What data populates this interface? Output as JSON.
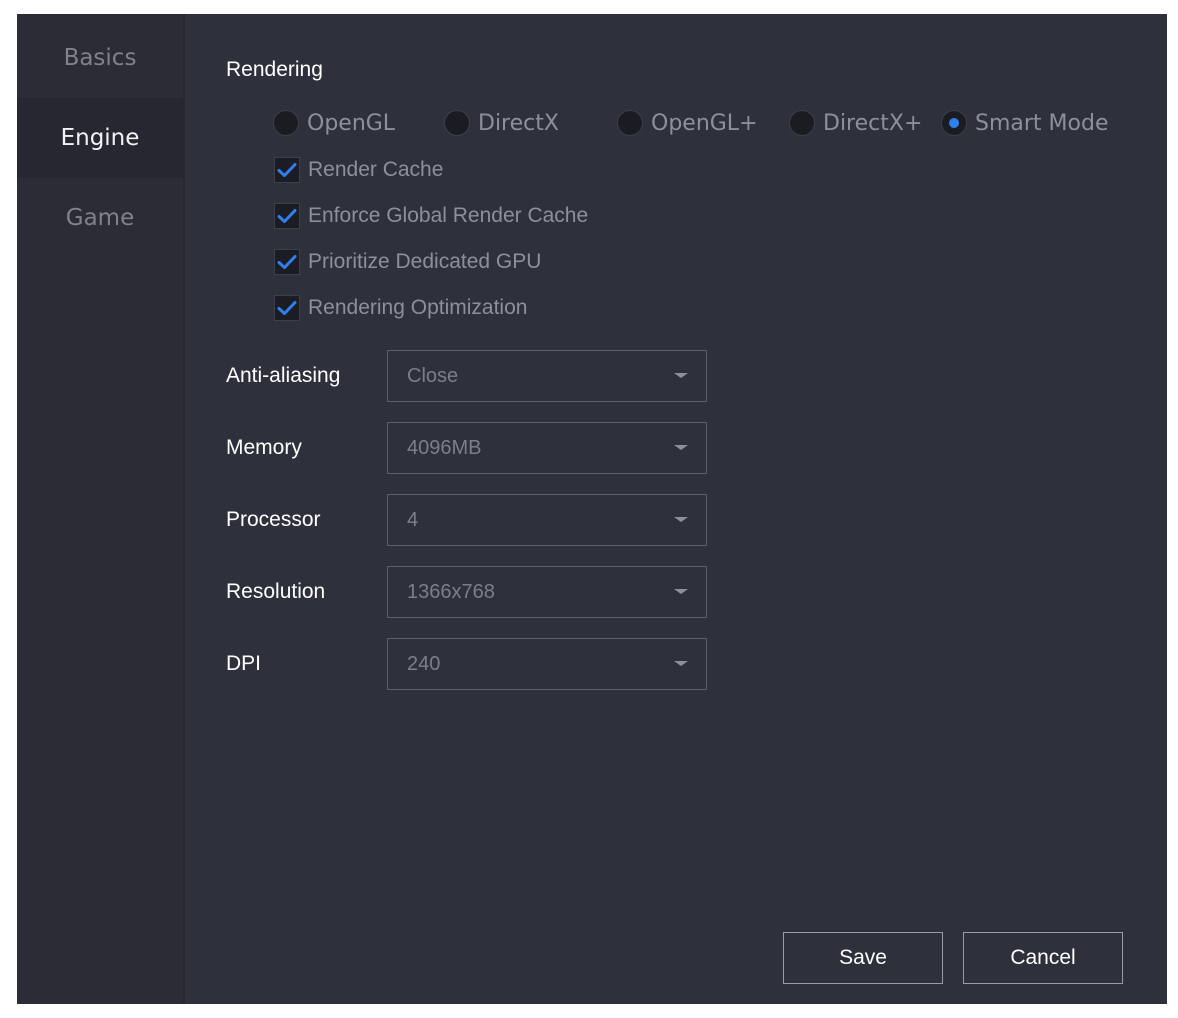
{
  "sidebar": {
    "items": [
      {
        "label": "Basics",
        "active": false
      },
      {
        "label": "Engine",
        "active": true
      },
      {
        "label": "Game",
        "active": false
      }
    ]
  },
  "rendering": {
    "title": "Rendering",
    "modes": [
      {
        "label": "OpenGL",
        "checked": false
      },
      {
        "label": "DirectX",
        "checked": false
      },
      {
        "label": "OpenGL+",
        "checked": false
      },
      {
        "label": "DirectX+",
        "checked": false
      },
      {
        "label": "Smart Mode",
        "checked": true
      }
    ],
    "options": [
      {
        "label": "Render Cache",
        "checked": true
      },
      {
        "label": "Enforce Global Render Cache",
        "checked": true
      },
      {
        "label": "Prioritize Dedicated GPU",
        "checked": true
      },
      {
        "label": "Rendering Optimization",
        "checked": true
      }
    ]
  },
  "settings": {
    "anti_aliasing": {
      "label": "Anti-aliasing",
      "value": "Close"
    },
    "memory": {
      "label": "Memory",
      "value": "4096MB"
    },
    "processor": {
      "label": "Processor",
      "value": "4"
    },
    "resolution": {
      "label": "Resolution",
      "value": "1366x768"
    },
    "dpi": {
      "label": "DPI",
      "value": "240"
    }
  },
  "actions": {
    "save_label": "Save",
    "cancel_label": "Cancel"
  },
  "colors": {
    "background": "#2e303c",
    "sidebar": "#2b2c36",
    "accent": "#2f80ed"
  },
  "icons": {
    "check": "checkmark-icon",
    "dropdown": "chevron-down-icon"
  }
}
